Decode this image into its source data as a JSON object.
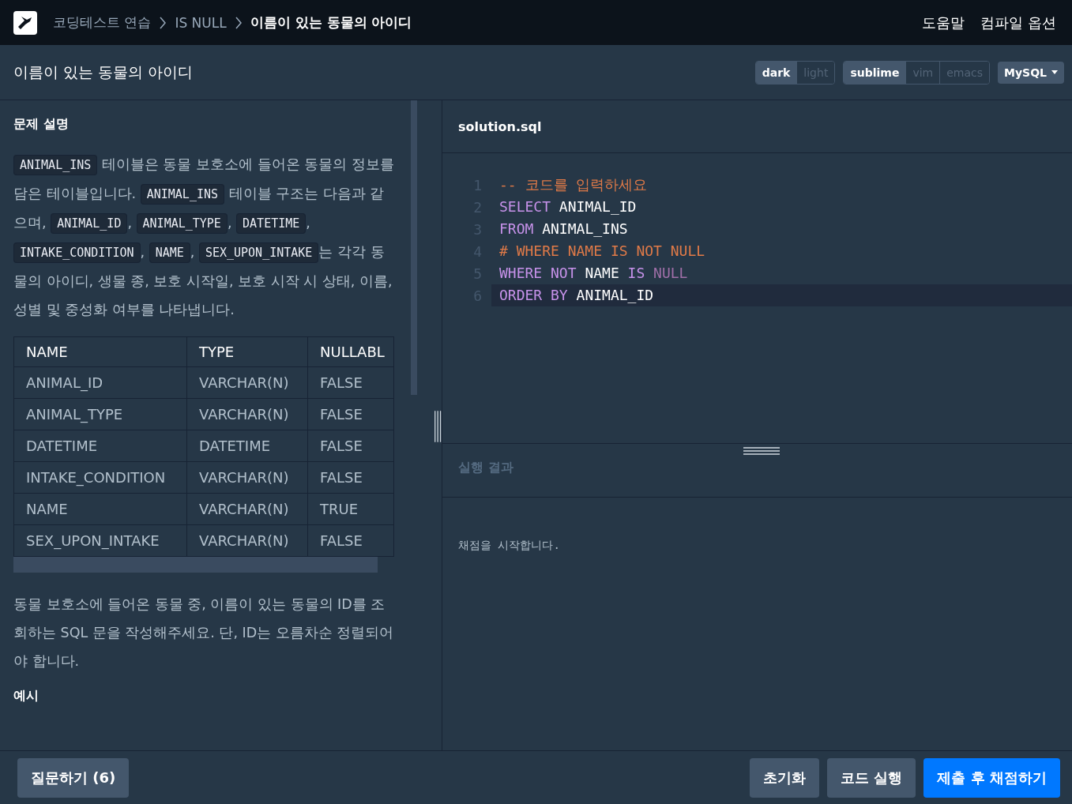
{
  "breadcrumbs": [
    {
      "label": "코딩테스트 연습",
      "current": false
    },
    {
      "label": "IS NULL",
      "current": false
    },
    {
      "label": "이름이 있는 동물의 아이디",
      "current": true
    }
  ],
  "header_links": [
    "도움말",
    "컴파일 옵션"
  ],
  "title": "이름이 있는 동물의 아이디",
  "toggle_groups": [
    [
      {
        "label": "dark",
        "selected": true
      },
      {
        "label": "light",
        "selected": false
      }
    ],
    [
      {
        "label": "sublime",
        "selected": true
      },
      {
        "label": "vim",
        "selected": false
      },
      {
        "label": "emacs",
        "selected": false
      }
    ]
  ],
  "language": "MySQL",
  "description": {
    "heading": "문제 설명",
    "intro": [
      {
        "kind": "code",
        "text": "ANIMAL_INS"
      },
      {
        "kind": "text",
        "text": " 테이블은 동물 보호소에 들어온 동물의 정보를 담은 테이블입니다. "
      },
      {
        "kind": "code",
        "text": "ANIMAL_INS"
      },
      {
        "kind": "text",
        "text": " 테이블 구조는 다음과 같으며, "
      },
      {
        "kind": "code",
        "text": "ANIMAL_ID"
      },
      {
        "kind": "text",
        "text": ", "
      },
      {
        "kind": "code",
        "text": "ANIMAL_TYPE"
      },
      {
        "kind": "text",
        "text": ", "
      },
      {
        "kind": "code",
        "text": "DATETIME"
      },
      {
        "kind": "text",
        "text": ", "
      },
      {
        "kind": "code",
        "text": "INTAKE_CONDITION"
      },
      {
        "kind": "text",
        "text": ", "
      },
      {
        "kind": "code",
        "text": "NAME"
      },
      {
        "kind": "text",
        "text": ", "
      },
      {
        "kind": "code",
        "text": "SEX_UPON_INTAKE"
      },
      {
        "kind": "text",
        "text": "는 각각 동물의 아이디, 생물 종, 보호 시작일, 보호 시작 시 상태, 이름, 성별 및 중성화 여부를 나타냅니다."
      }
    ],
    "table": {
      "columns": [
        "NAME",
        "TYPE",
        "NULLABL"
      ],
      "rows": [
        [
          "ANIMAL_ID",
          "VARCHAR(N)",
          "FALSE"
        ],
        [
          "ANIMAL_TYPE",
          "VARCHAR(N)",
          "FALSE"
        ],
        [
          "DATETIME",
          "DATETIME",
          "FALSE"
        ],
        [
          "INTAKE_CONDITION",
          "VARCHAR(N)",
          "FALSE"
        ],
        [
          "NAME",
          "VARCHAR(N)",
          "TRUE"
        ],
        [
          "SEX_UPON_INTAKE",
          "VARCHAR(N)",
          "FALSE"
        ]
      ]
    },
    "task": "동물 보호소에 들어온 동물 중, 이름이 있는 동물의 ID를 조회하는 SQL 문을 작성해주세요. 단, ID는 오름차순 정렬되어야 합니다.",
    "next_heading": "예시"
  },
  "editor": {
    "filename": "solution.sql",
    "lines": [
      {
        "number": "1",
        "selected": false,
        "tokens": [
          {
            "kind": "comment",
            "text": "-- 코드를 입력하세요"
          }
        ]
      },
      {
        "number": "2",
        "selected": false,
        "tokens": [
          {
            "kind": "keyword",
            "text": "SELECT"
          },
          {
            "kind": "ident",
            "text": " ANIMAL_ID"
          }
        ]
      },
      {
        "number": "3",
        "selected": false,
        "tokens": [
          {
            "kind": "keyword",
            "text": "FROM"
          },
          {
            "kind": "ident",
            "text": " ANIMAL_INS"
          }
        ]
      },
      {
        "number": "4",
        "selected": false,
        "tokens": [
          {
            "kind": "comment",
            "text": "# WHERE NAME IS NOT NULL"
          }
        ]
      },
      {
        "number": "5",
        "selected": false,
        "tokens": [
          {
            "kind": "keyword",
            "text": "WHERE NOT"
          },
          {
            "kind": "ident",
            "text": " NAME "
          },
          {
            "kind": "keyword",
            "text": "IS"
          },
          {
            "kind": "null",
            "text": " NULL"
          }
        ]
      },
      {
        "number": "6",
        "selected": true,
        "tokens": [
          {
            "kind": "keyword",
            "text": "ORDER BY"
          },
          {
            "kind": "ident",
            "text": " ANIMAL_ID"
          }
        ]
      }
    ]
  },
  "result": {
    "heading": "실행 결과",
    "output": "채점을 시작합니다."
  },
  "footer": {
    "ask_button": "질문하기 (6)",
    "buttons": [
      {
        "label": "초기화",
        "kind": "secondary"
      },
      {
        "label": "코드 실행",
        "kind": "secondary"
      },
      {
        "label": "제출 후 채점하기",
        "kind": "primary"
      }
    ]
  }
}
